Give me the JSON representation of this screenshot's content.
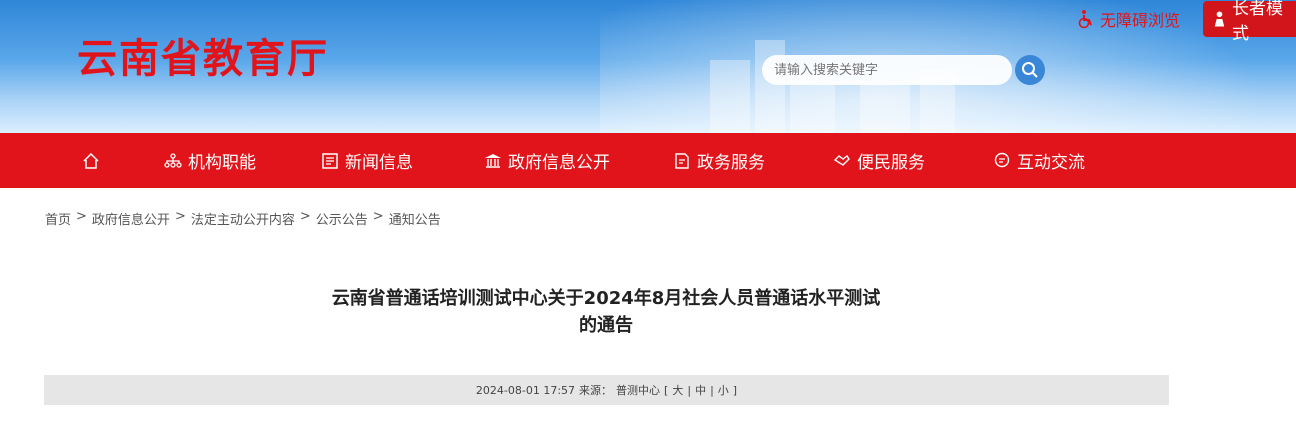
{
  "header": {
    "site_title": "云南省教育厅",
    "accessible_label": "无障碍浏览",
    "elder_label": "长者模式",
    "search_placeholder": "请输入搜索关键字"
  },
  "nav": {
    "items": [
      {
        "label": "机构职能",
        "icon": "org-chart-icon"
      },
      {
        "label": "新闻信息",
        "icon": "newspaper-icon"
      },
      {
        "label": "政府信息公开",
        "icon": "government-building-icon"
      },
      {
        "label": "政务服务",
        "icon": "service-document-icon"
      },
      {
        "label": "便民服务",
        "icon": "handshake-icon"
      },
      {
        "label": "互动交流",
        "icon": "chat-icon"
      }
    ],
    "home_icon": "home-icon"
  },
  "breadcrumb": [
    "首页",
    "政府信息公开",
    "法定主动公开内容",
    "公示公告",
    "通知公告"
  ],
  "breadcrumb_sep": ">",
  "article": {
    "title_line1": "云南省普通话培训测试中心关于2024年8月社会人员普通话水平测试",
    "title_line2": "的通告",
    "date": "2024-08-01 17:57",
    "source_label": "来源：",
    "source": "普测中心",
    "font_size_open": "[",
    "font_large": "大",
    "font_medium": "中",
    "font_small": "小",
    "font_sep": "|",
    "font_size_close": "]"
  },
  "colors": {
    "brand_red": "#e1141b",
    "search_blue": "#3a87d8"
  }
}
